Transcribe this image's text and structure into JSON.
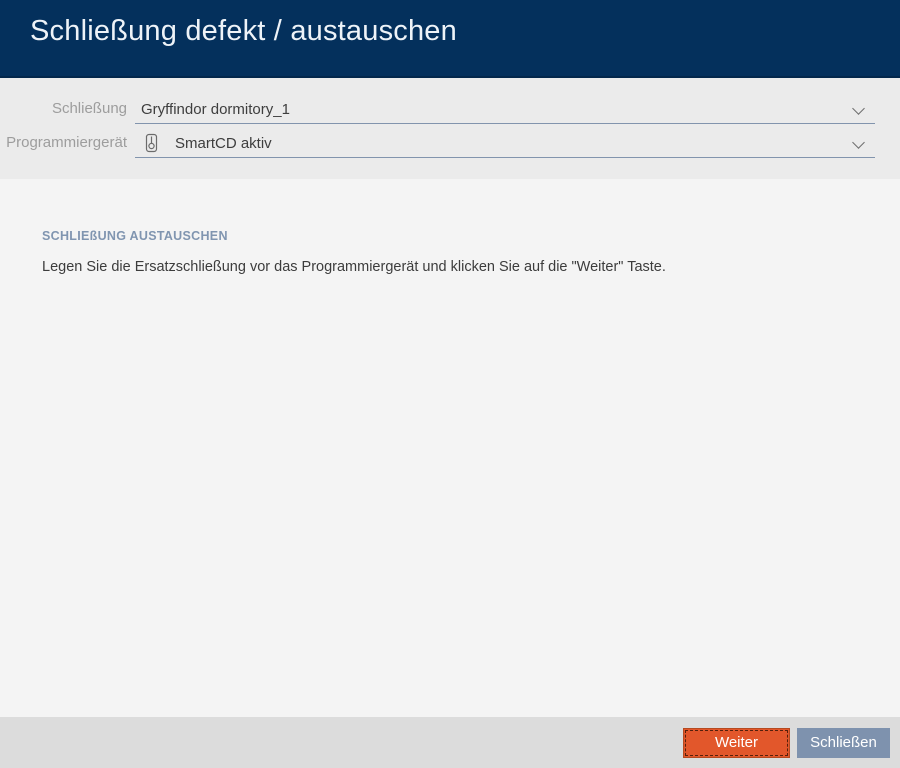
{
  "dialog": {
    "title": "Schließung defekt / austauschen"
  },
  "form": {
    "fields": [
      {
        "label": "Schließung",
        "value": "Gryffindor dormitory_1",
        "icon": null
      },
      {
        "label": "Programmiergerät",
        "value": "SmartCD aktiv",
        "icon": "programmer-device-icon"
      }
    ]
  },
  "content": {
    "section_title": "SCHLIEßUNG AUSTAUSCHEN",
    "instruction": "Legen Sie die Ersatzschließung vor das Programmiergerät und klicken Sie auf die \"Weiter\" Taste."
  },
  "footer": {
    "next_label": "Weiter",
    "close_label": "Schließen"
  },
  "colors": {
    "header_bg": "#04305c",
    "accent_orange": "#e2572b",
    "slate_blue": "#7e92ae",
    "section_title": "#8095b0",
    "field_underline": "#8294ad",
    "form_bg": "#ebebeb",
    "content_bg": "#f4f4f4",
    "footer_bg": "#dcdcdc"
  }
}
